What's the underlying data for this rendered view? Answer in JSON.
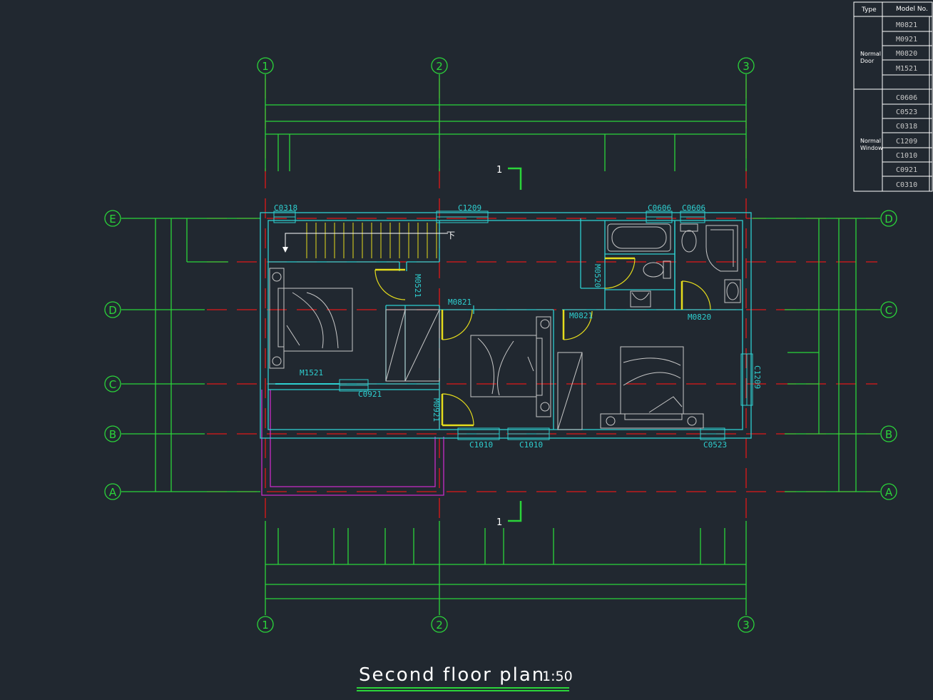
{
  "title": "Second floor plan",
  "scale": "1:50",
  "axes": {
    "columns": [
      "1",
      "2",
      "3"
    ],
    "rows_left": [
      "E",
      "D",
      "C",
      "B",
      "A"
    ],
    "rows_right": [
      "D",
      "C",
      "B",
      "A"
    ]
  },
  "section_mark": "1",
  "stair_label": "下",
  "opening_labels": [
    "C0318",
    "C1209",
    "C0606",
    "C0606",
    "M0521",
    "M0821",
    "M0821",
    "M0820",
    "M0520",
    "M1521",
    "C0921",
    "M0921",
    "C1010",
    "C1010",
    "C0523",
    "C1209"
  ],
  "schedule": {
    "header_type": "Type",
    "header_model": "Model No.",
    "groups": [
      {
        "type_line1": "Normal",
        "type_line2": "Door",
        "models": [
          "M0821",
          "M0921",
          "M0820",
          "M1521",
          ""
        ]
      },
      {
        "type_line1": "Normal",
        "type_line2": "Window",
        "models": [
          "C0606",
          "C0523",
          "C0318",
          "C1209",
          "C1010",
          "C0921",
          "C0310"
        ]
      }
    ]
  },
  "colors": {
    "background": "#212830",
    "axis": "#2bd43a",
    "grid": "#e01818",
    "wall": "#2ecfd0",
    "furniture": "#c8c8c8",
    "door": "#e5dc1c",
    "balcony": "#c82cc8"
  }
}
